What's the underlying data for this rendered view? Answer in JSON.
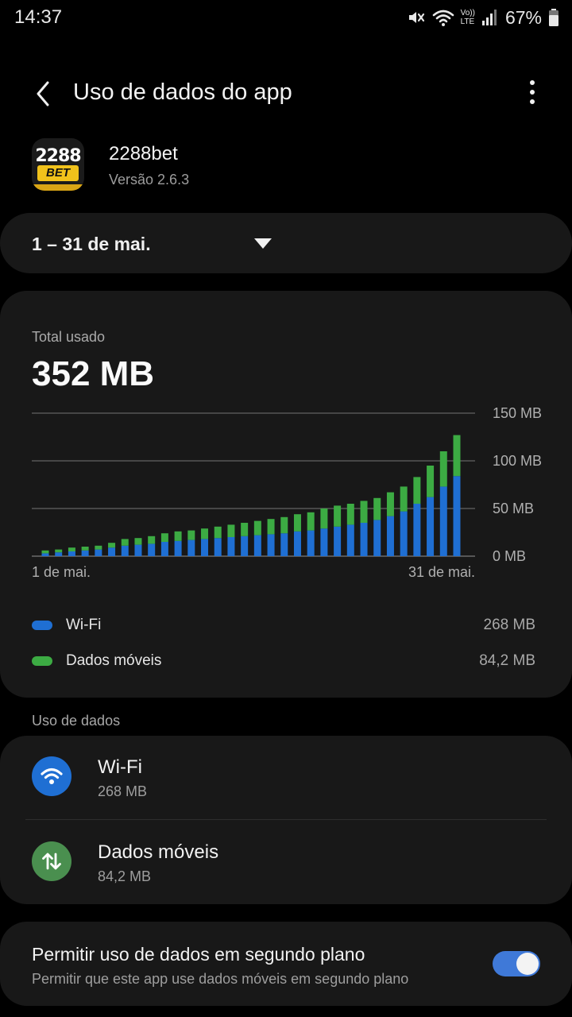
{
  "status_bar": {
    "time": "14:37",
    "battery": "67%",
    "icons": [
      "mute-icon",
      "wifi-icon",
      "volte-icon",
      "signal-icon",
      "battery-icon"
    ],
    "volte_top": "Vo))",
    "volte_bottom": "LTE"
  },
  "app_bar": {
    "title": "Uso de dados do app",
    "back_icon": "back-arrow-icon",
    "more_icon": "more-vert-icon"
  },
  "app": {
    "name": "2288bet",
    "version": "Versão 2.6.3",
    "icon_top": "2288",
    "icon_mid": "BET"
  },
  "period": {
    "label": "1 – 31 de mai."
  },
  "usage": {
    "total_label": "Total usado",
    "total_value": "352 MB"
  },
  "chart_data": {
    "type": "bar",
    "stacked": true,
    "x_start_label": "1 de mai.",
    "x_end_label": "31 de mai.",
    "y_tick_labels": [
      "150 MB",
      "100 MB",
      "50 MB",
      "0 MB"
    ],
    "ylim": [
      0,
      150
    ],
    "series": [
      {
        "name": "Wi-Fi",
        "color": "#1f6fd3",
        "values": [
          3,
          4,
          5,
          6,
          7,
          9,
          11,
          12,
          13,
          15,
          16,
          17,
          18,
          19,
          20,
          21,
          22,
          23,
          24,
          26,
          27,
          29,
          31,
          33,
          35,
          38,
          42,
          47,
          55,
          62,
          73,
          84
        ]
      },
      {
        "name": "Dados móveis",
        "color": "#3cab43",
        "values": [
          3,
          3,
          4,
          4,
          4,
          5,
          7,
          7,
          8,
          9,
          10,
          10,
          11,
          12,
          13,
          14,
          15,
          16,
          17,
          18,
          19,
          21,
          22,
          22,
          23,
          23,
          25,
          26,
          28,
          33,
          37,
          43
        ]
      }
    ]
  },
  "legend": {
    "wifi_label": "Wi-Fi",
    "wifi_value": "268 MB",
    "wifi_color": "#1f6fd3",
    "mobile_label": "Dados móveis",
    "mobile_value": "84,2 MB",
    "mobile_color": "#3cab43"
  },
  "data_usage_section": {
    "label": "Uso de dados",
    "items": [
      {
        "title": "Wi-Fi",
        "value": "268 MB",
        "icon": "wifi-icon",
        "color": "#1f6fd3"
      },
      {
        "title": "Dados móveis",
        "value": "84,2 MB",
        "icon": "mobile-data-icon",
        "color": "#4a8f4f"
      }
    ]
  },
  "background_data": {
    "title": "Permitir uso de dados em segundo plano",
    "subtitle": "Permitir que este app use dados móveis em segundo plano",
    "enabled": true
  }
}
